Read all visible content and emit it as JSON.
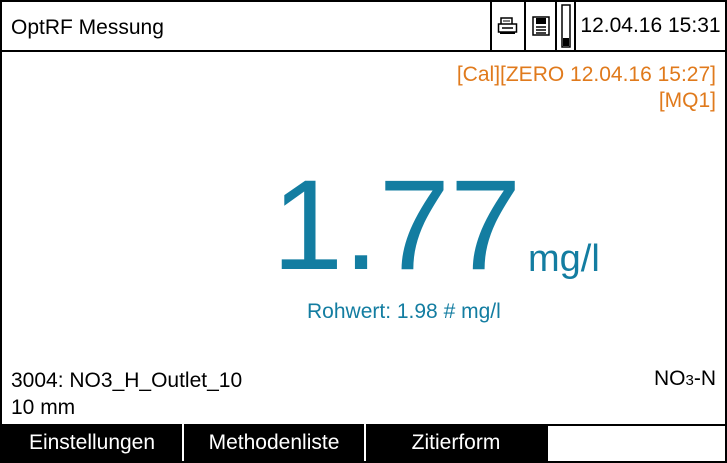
{
  "header": {
    "title": "OptRF Messung",
    "datetime": "12.04.16 15:31",
    "icons": [
      "printer-icon",
      "storage-icon",
      "battery-icon"
    ]
  },
  "calibration": {
    "line1": "[Cal][ZERO 12.04.16 15:27]",
    "line2": "[MQ1]"
  },
  "measurement": {
    "value": "1.77",
    "unit": "mg/l",
    "raw": "Rohwert: 1.98 # mg/l"
  },
  "method": {
    "name": "3004: NO3_H_Outlet_10",
    "cuvette": "10 mm"
  },
  "parameter": {
    "base": "NO",
    "sub": "3",
    "suffix": "-N"
  },
  "softkeys": [
    "Einstellungen",
    "Methodenliste",
    "Zitierform",
    ""
  ],
  "colors": {
    "value": "#137da1",
    "calibration": "#e07a1c",
    "softkey_bg": "#000000"
  }
}
